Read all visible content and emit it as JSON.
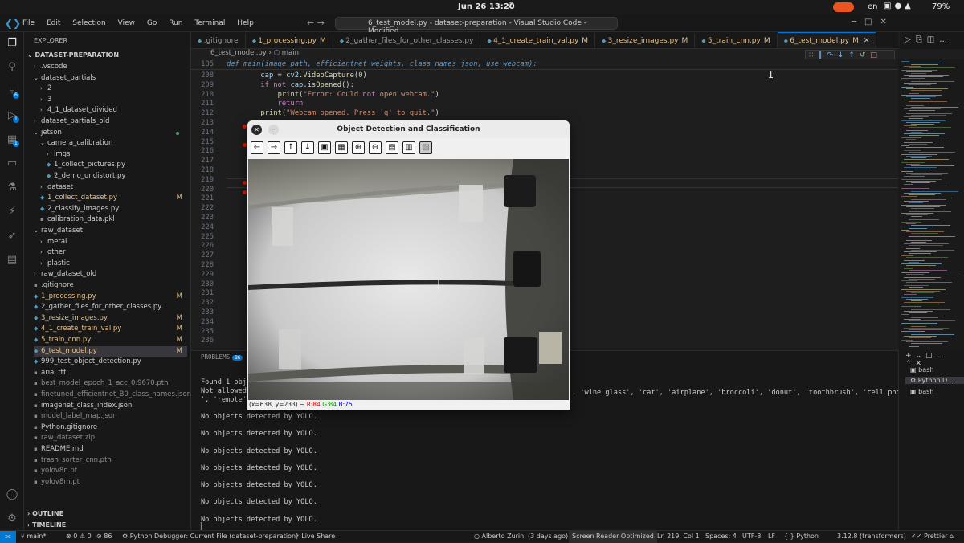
{
  "system": {
    "clock": "Jun 26  13:20",
    "language": "en",
    "battery": "79%"
  },
  "menubar": {
    "items": [
      "File",
      "Edit",
      "Selection",
      "View",
      "Go",
      "Run",
      "Terminal",
      "Help"
    ],
    "command_center": "6_test_model.py - dataset-preparation - Visual Studio Code - Modified"
  },
  "activity": {
    "scm_badge": "6",
    "debug_badge": "1",
    "ext_badge": "1"
  },
  "sidebar": {
    "title": "EXPLORER",
    "root": "DATASET-PREPARATION",
    "items": [
      {
        "label": ".vscode",
        "kind": "folder",
        "state": "closed",
        "depth": 1
      },
      {
        "label": "dataset_partials",
        "kind": "folder",
        "state": "open",
        "depth": 1
      },
      {
        "label": "2",
        "kind": "folder",
        "state": "closed",
        "depth": 2
      },
      {
        "label": "3",
        "kind": "folder",
        "state": "closed",
        "depth": 2
      },
      {
        "label": "4_1_dataset_divided",
        "kind": "folder",
        "state": "closed",
        "depth": 2
      },
      {
        "label": "dataset_partials_old",
        "kind": "folder",
        "state": "closed",
        "depth": 1
      },
      {
        "label": "jetson",
        "kind": "folder",
        "state": "open",
        "depth": 1,
        "dot": true
      },
      {
        "label": "camera_calibration",
        "kind": "folder",
        "state": "open",
        "depth": 2
      },
      {
        "label": "imgs",
        "kind": "folder",
        "state": "closed",
        "depth": 3
      },
      {
        "label": "1_collect_pictures.py",
        "kind": "py",
        "depth": 3
      },
      {
        "label": "2_demo_undistort.py",
        "kind": "py",
        "depth": 3
      },
      {
        "label": "dataset",
        "kind": "folder",
        "state": "closed",
        "depth": 2
      },
      {
        "label": "1_collect_dataset.py",
        "kind": "py",
        "depth": 2,
        "mod": "M"
      },
      {
        "label": "2_classify_images.py",
        "kind": "py",
        "depth": 2
      },
      {
        "label": "calibration_data.pkl",
        "kind": "file",
        "depth": 2
      },
      {
        "label": "raw_dataset",
        "kind": "folder",
        "state": "open",
        "depth": 1
      },
      {
        "label": "metal",
        "kind": "folder",
        "state": "closed",
        "depth": 2
      },
      {
        "label": "other",
        "kind": "folder",
        "state": "closed",
        "depth": 2
      },
      {
        "label": "plastic",
        "kind": "folder",
        "state": "closed",
        "depth": 2
      },
      {
        "label": "raw_dataset_old",
        "kind": "folder",
        "state": "closed",
        "depth": 1
      },
      {
        "label": ".gitignore",
        "kind": "file",
        "depth": 1
      },
      {
        "label": "1_processing.py",
        "kind": "py",
        "depth": 1,
        "mod": "M"
      },
      {
        "label": "2_gather_files_for_other_classes.py",
        "kind": "py",
        "depth": 1
      },
      {
        "label": "3_resize_images.py",
        "kind": "py",
        "depth": 1,
        "mod": "M"
      },
      {
        "label": "4_1_create_train_val.py",
        "kind": "py",
        "depth": 1,
        "mod": "M"
      },
      {
        "label": "5_train_cnn.py",
        "kind": "py",
        "depth": 1,
        "mod": "M"
      },
      {
        "label": "6_test_model.py",
        "kind": "py",
        "depth": 1,
        "mod": "M",
        "selected": true
      },
      {
        "label": "999_test_object_detection.py",
        "kind": "py",
        "depth": 1
      },
      {
        "label": "arial.ttf",
        "kind": "file",
        "depth": 1
      },
      {
        "label": "best_model_epoch_1_acc_0.9670.pth",
        "kind": "file",
        "depth": 1,
        "dim": true
      },
      {
        "label": "finetuned_efficientnet_B0_class_names.json",
        "kind": "file",
        "depth": 1,
        "dim": true
      },
      {
        "label": "imagenet_class_index.json",
        "kind": "file",
        "depth": 1
      },
      {
        "label": "model_label_map.json",
        "kind": "file",
        "depth": 1,
        "dim": true
      },
      {
        "label": "Python.gitignore",
        "kind": "file",
        "depth": 1
      },
      {
        "label": "raw_dataset.zip",
        "kind": "file",
        "depth": 1,
        "dim": true
      },
      {
        "label": "README.md",
        "kind": "file",
        "depth": 1
      },
      {
        "label": "trash_sorter_cnn.pth",
        "kind": "file",
        "depth": 1,
        "dim": true
      },
      {
        "label": "yolov8n.pt",
        "kind": "file",
        "depth": 1,
        "dim": true
      },
      {
        "label": "yolov8m.pt",
        "kind": "file",
        "depth": 1,
        "dim": true
      }
    ],
    "outline": "OUTLINE",
    "timeline": "TIMELINE"
  },
  "tabs": [
    {
      "label": ".gitignore",
      "mod": ""
    },
    {
      "label": "1_processing.py",
      "mod": "M"
    },
    {
      "label": "2_gather_files_for_other_classes.py",
      "mod": ""
    },
    {
      "label": "4_1_create_train_val.py",
      "mod": "M"
    },
    {
      "label": "3_resize_images.py",
      "mod": "M"
    },
    {
      "label": "5_train_cnn.py",
      "mod": "M"
    },
    {
      "label": "6_test_model.py",
      "mod": "M",
      "active": true
    }
  ],
  "breadcrumbs": {
    "file": "6_test_model.py",
    "symbol": "main"
  },
  "editor": {
    "sticky_line_number": "185",
    "sticky_line": "def main(image_path, efficientnet_weights, class_names_json, use_webcam):",
    "lines": [
      {
        "n": "208",
        "text": "        cap = cv2.VideoCapture(0)"
      },
      {
        "n": "209",
        "text": "        if not cap.isOpened():"
      },
      {
        "n": "210",
        "text": "            print(\"Error: Could not open webcam.\")"
      },
      {
        "n": "211",
        "text": "            return"
      },
      {
        "n": "212",
        "text": "        print(\"Webcam opened. Press 'q' to quit.\")"
      },
      {
        "n": "213",
        "text": ""
      },
      {
        "n": "214",
        "text": ""
      },
      {
        "n": "215",
        "text": ""
      },
      {
        "n": "216",
        "text": ""
      },
      {
        "n": "217",
        "text": ""
      },
      {
        "n": "218",
        "text": ""
      },
      {
        "n": "219",
        "text": ""
      },
      {
        "n": "220",
        "text": ""
      },
      {
        "n": "221",
        "text": ""
      },
      {
        "n": "222",
        "text": ""
      },
      {
        "n": "223",
        "text": ""
      },
      {
        "n": "224",
        "text": ""
      },
      {
        "n": "225",
        "text": ""
      },
      {
        "n": "226",
        "text": ""
      },
      {
        "n": "227",
        "text": ""
      },
      {
        "n": "228",
        "text": ""
      },
      {
        "n": "229",
        "text": ""
      },
      {
        "n": "230",
        "text": ""
      },
      {
        "n": "231",
        "text": ""
      },
      {
        "n": "232",
        "text": ""
      },
      {
        "n": "233",
        "text": ""
      },
      {
        "n": "234",
        "text": ""
      },
      {
        "n": "235",
        "text": ""
      },
      {
        "n": "236",
        "text": ""
      }
    ]
  },
  "panel": {
    "tab": "PROBLEMS",
    "badge": "86",
    "output": [
      "Found 1 obje",
      "Not allowed",
      "', 'remote'",
      "No objects detected by YOLO.",
      "No objects detected by YOLO.",
      "No objects detected by YOLO.",
      "No objects detected by YOLO.",
      "No objects detected by YOLO.",
      "No objects detected by YOLO.",
      "No objects detected by YOLO."
    ],
    "output_tail": ", 'wine glass', 'cat', 'airplane', 'broccoli', 'donut', 'toothbrush', 'cell phone"
  },
  "terminals": [
    "bash",
    "Python D...",
    "bash"
  ],
  "cv_window": {
    "title": "Object Detection and Classification",
    "status_coords": "(x=638, y=233) ~",
    "status_r": "R:84",
    "status_g": "G:84",
    "status_b": "B:75"
  },
  "statusbar": {
    "branch": "main*",
    "problems": "⊗ 0 ⚠ 0",
    "ports": "86",
    "debugger": "Python Debugger: Current File (dataset-preparation)",
    "live_share": "Live Share",
    "blame": "Alberto Zurini (3 days ago)",
    "screen_reader": "Screen Reader Optimized",
    "position": "Ln 219, Col 1",
    "spaces": "Spaces: 4",
    "encoding": "UTF-8",
    "eol": "LF",
    "language": "Python",
    "interpreter": "3.12.8 (transformers)",
    "prettier": "Prettier"
  },
  "colors": {
    "accent": "#0078d4",
    "modified": "#e2c08d",
    "breakpoint": "#e51400"
  }
}
